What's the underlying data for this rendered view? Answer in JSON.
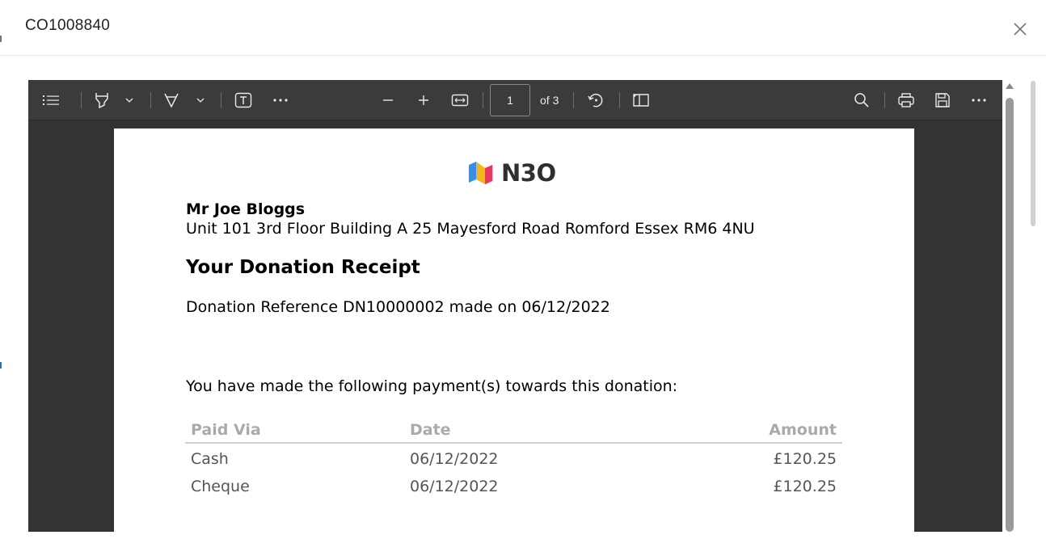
{
  "dialog": {
    "title": "CO1008840"
  },
  "toolbar": {
    "page_number": "1",
    "page_of": "of 3",
    "icons": [
      "contents-icon",
      "highlight-icon",
      "draw-icon",
      "text-icon",
      "more-icon",
      "zoom-out-icon",
      "zoom-in-icon",
      "fit-width-icon",
      "rotate-icon",
      "page-view-icon",
      "search-icon",
      "print-icon",
      "save-icon",
      "more-icon"
    ]
  },
  "document": {
    "logo_text": "N3O",
    "name": "Mr Joe Bloggs",
    "address": "Unit 101 3rd Floor Building A 25 Mayesford Road Romford Essex RM6 4NU",
    "heading": "Your Donation Receipt",
    "reference_line": "Donation Reference DN10000002 made on 06/12/2022",
    "intro": "You have made the following payment(s) towards this donation:",
    "table": {
      "headers": [
        "Paid Via",
        "Date",
        "Amount"
      ],
      "rows": [
        [
          "Cash",
          "06/12/2022",
          "£120.25"
        ],
        [
          "Cheque",
          "06/12/2022",
          "£120.25"
        ]
      ]
    }
  },
  "colors": {
    "toolbar_bg": "#3b3b3b",
    "viewer_bg": "#333333",
    "logo_blue": "#3a8ee6",
    "logo_yellow": "#f5b51b",
    "logo_pink": "#e8385f"
  }
}
